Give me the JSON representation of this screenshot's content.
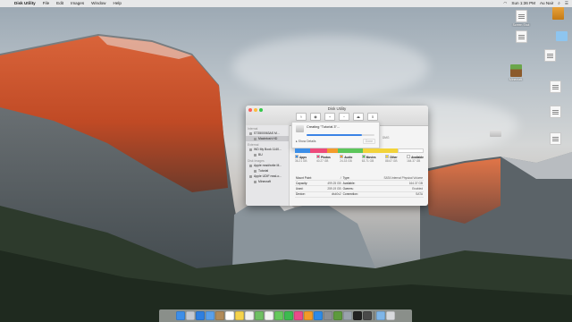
{
  "menubar": {
    "app": "Disk Utility",
    "items": [
      "File",
      "Edit",
      "Images",
      "Window",
      "Help"
    ],
    "clock": "Sun 1:36 PM",
    "user": "Au Nair"
  },
  "desktop": {
    "icons": [
      {
        "label": "Screen Shot",
        "kind": "doc"
      },
      {
        "label": "",
        "kind": "pkg"
      },
      {
        "label": "",
        "kind": "doc"
      },
      {
        "label": "",
        "kind": "folder"
      },
      {
        "label": "",
        "kind": "doc"
      },
      {
        "label": "Minecraft",
        "kind": "game"
      },
      {
        "label": "",
        "kind": "doc"
      },
      {
        "label": "",
        "kind": "doc"
      },
      {
        "label": "",
        "kind": "hdd"
      },
      {
        "label": "",
        "kind": "doc"
      }
    ]
  },
  "window": {
    "title": "Disk Utility",
    "toolbar": [
      "+",
      "−",
      "⚕",
      "◉",
      "⏏",
      "ℹ"
    ],
    "sidebar": {
      "internal_header": "Internal",
      "internal": [
        {
          "label": "ST3500063AS M...",
          "sub": false,
          "selected": false
        },
        {
          "label": "Macintosh HD",
          "sub": true,
          "selected": true
        }
      ],
      "external_header": "External",
      "external": [
        {
          "label": "WD My Book 1140...",
          "sub": false,
          "selected": false
        },
        {
          "label": "BU",
          "sub": true,
          "selected": false
        }
      ],
      "images_header": "Disk Images",
      "images": [
        {
          "label": "Apple read/write M...",
          "sub": false,
          "selected": false
        },
        {
          "label": "Tutorial",
          "sub": true,
          "selected": false
        },
        {
          "label": "Apple UDIF read-o...",
          "sub": false,
          "selected": false
        },
        {
          "label": "Minecraft",
          "sub": true,
          "selected": false
        }
      ]
    },
    "sheet": {
      "message": "Creating \"Tutorial 3\"...",
      "details_label": "Show Details",
      "done_label": "Done",
      "progress": 0.82
    },
    "side_text": "DMG",
    "usage": [
      {
        "name": "Apps",
        "size": "36.21 GB",
        "color": "#3b8ee8",
        "share": 0.12
      },
      {
        "name": "Photos",
        "size": "40.27 GB",
        "color": "#ee4a7a",
        "share": 0.13
      },
      {
        "name": "Audio",
        "size": "24.33 GB",
        "color": "#f39b2b",
        "share": 0.08
      },
      {
        "name": "Movies",
        "size": "63.71 GB",
        "color": "#5cc65a",
        "share": 0.2
      },
      {
        "name": "Other",
        "size": "88.67 GB",
        "color": "#f2d33a",
        "share": 0.27
      },
      {
        "name": "Available",
        "size": "164.37 GB",
        "color": "#ffffff",
        "share": 0.2
      }
    ],
    "info": [
      [
        "Mount Point:",
        "/",
        "Type:",
        "SATA Internal Physical Volume"
      ],
      [
        "Capacity:",
        "499.25 GB",
        "Available:",
        "164.37 GB"
      ],
      [
        "Used:",
        "259.19 GB",
        "Owners:",
        "Enabled"
      ],
      [
        "Device:",
        "disk0s2",
        "Connection:",
        "SATA"
      ]
    ]
  },
  "dock": {
    "apps": [
      {
        "name": "Finder",
        "color": "#3e8ee8"
      },
      {
        "name": "Launchpad",
        "color": "#c5c9d1"
      },
      {
        "name": "Safari",
        "color": "#2f7fe0"
      },
      {
        "name": "Mail",
        "color": "#5aa0ea"
      },
      {
        "name": "Contacts",
        "color": "#b08b5a"
      },
      {
        "name": "Calendar",
        "color": "#ffffff"
      },
      {
        "name": "Notes",
        "color": "#f5d34b"
      },
      {
        "name": "Reminders",
        "color": "#f1f1f1"
      },
      {
        "name": "Maps",
        "color": "#6fbf63"
      },
      {
        "name": "Photos",
        "color": "#f3f3f3"
      },
      {
        "name": "Messages",
        "color": "#66c85c"
      },
      {
        "name": "FaceTime",
        "color": "#3dbb4f"
      },
      {
        "name": "iTunes",
        "color": "#e94b8a"
      },
      {
        "name": "iBooks",
        "color": "#f29b27"
      },
      {
        "name": "App Store",
        "color": "#2d8ae6"
      },
      {
        "name": "System Preferences",
        "color": "#8c8f93"
      },
      {
        "name": "Minecraft",
        "color": "#5d9a3d"
      },
      {
        "name": "Disk Utility",
        "color": "#9aa2ac"
      },
      {
        "name": "Terminal",
        "color": "#222222"
      },
      {
        "name": "Activity Monitor",
        "color": "#4a4a4a"
      }
    ],
    "right": [
      {
        "name": "Downloads",
        "color": "#7fb6e8"
      },
      {
        "name": "Trash",
        "color": "#d8dadd"
      }
    ]
  }
}
